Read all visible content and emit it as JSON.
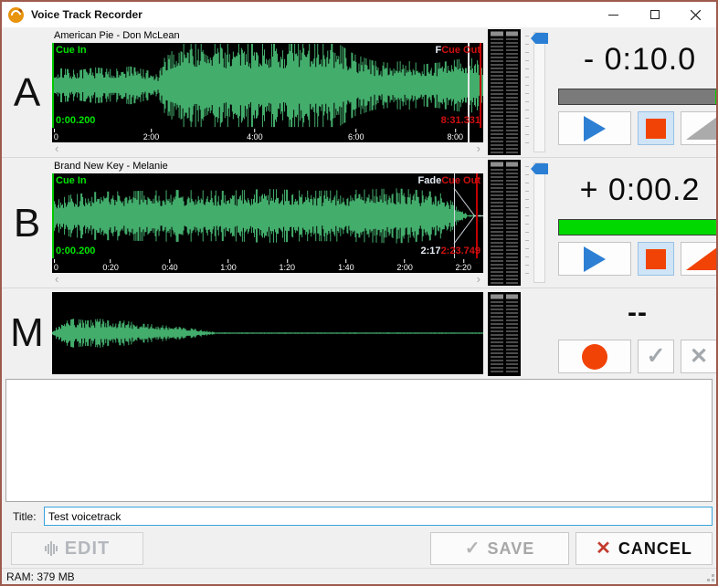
{
  "window": {
    "title": "Voice Track Recorder",
    "minimize": "minimize",
    "maximize": "maximize",
    "close": "close"
  },
  "colors": {
    "wave_green": "#43ad6c",
    "cue_green": "#00e400",
    "cue_red": "#d01010",
    "play_blue": "#2d7fd3",
    "stop_orange": "#f14306",
    "progress_green": "#00d800",
    "progress_gray": "#7a7a7a",
    "window_border": "#9d5b4d",
    "focus_blue": "#38a3dc"
  },
  "tracks": [
    {
      "label": "A",
      "song": "American Pie - Don McLean",
      "cue_in_label": "Cue In",
      "cue_in_time": "0:00.200",
      "fade_label": "F",
      "cue_out_label": "Cue Out",
      "fade_time": "",
      "cue_out_time": "8:31.331",
      "time_display": "- 0:10.0",
      "ruler": [
        {
          "t": "0",
          "p": 0.4
        },
        {
          "t": "2:00",
          "p": 23
        },
        {
          "t": "4:00",
          "p": 47
        },
        {
          "t": "6:00",
          "p": 70.5
        },
        {
          "t": "8:00",
          "p": 93.5
        }
      ],
      "playhead_pct": 96.4,
      "cueout_line_pct": 99.2,
      "progress": {
        "elapsed_pct": 96.5
      },
      "waveform": {
        "seed": 7,
        "envelope": [
          [
            0,
            0.22
          ],
          [
            0.02,
            0.34
          ],
          [
            0.06,
            0.3
          ],
          [
            0.1,
            0.36
          ],
          [
            0.14,
            0.32
          ],
          [
            0.18,
            0.38
          ],
          [
            0.22,
            0.3
          ],
          [
            0.245,
            0.2
          ],
          [
            0.27,
            0.8
          ],
          [
            0.32,
            0.9
          ],
          [
            0.45,
            0.88
          ],
          [
            0.5,
            0.92
          ],
          [
            0.55,
            0.85
          ],
          [
            0.6,
            0.9
          ],
          [
            0.66,
            0.85
          ],
          [
            0.7,
            0.62
          ],
          [
            0.74,
            0.5
          ],
          [
            0.78,
            0.45
          ],
          [
            0.82,
            0.5
          ],
          [
            0.86,
            0.42
          ],
          [
            0.9,
            0.46
          ],
          [
            0.94,
            0.52
          ],
          [
            0.97,
            0.55
          ],
          [
            1,
            0.45
          ]
        ]
      }
    },
    {
      "label": "B",
      "song": "Brand New Key - Melanie",
      "cue_in_label": "Cue In",
      "cue_in_time": "0:00.200",
      "fade_label": "Fade",
      "cue_out_label": "Cue Out",
      "fade_time": "2:17",
      "cue_out_time": "2:23.749",
      "time_display": "+ 0:00.2",
      "ruler": [
        {
          "t": "0",
          "p": 0.4
        },
        {
          "t": "0:20",
          "p": 13.6
        },
        {
          "t": "0:40",
          "p": 27.3
        },
        {
          "t": "1:00",
          "p": 40.9
        },
        {
          "t": "1:20",
          "p": 54.5
        },
        {
          "t": "1:40",
          "p": 68.2
        },
        {
          "t": "2:00",
          "p": 81.8
        },
        {
          "t": "2:20",
          "p": 95.4
        }
      ],
      "fade_start_pct": 93.2,
      "fade_apex_pct": 98.0,
      "cueout_line_pct": 98.3,
      "progress": {
        "elapsed_pct": 0
      },
      "waveform": {
        "seed": 21,
        "envelope": [
          [
            0,
            0.28
          ],
          [
            0.04,
            0.42
          ],
          [
            0.1,
            0.48
          ],
          [
            0.2,
            0.5
          ],
          [
            0.3,
            0.52
          ],
          [
            0.4,
            0.5
          ],
          [
            0.5,
            0.54
          ],
          [
            0.6,
            0.5
          ],
          [
            0.7,
            0.52
          ],
          [
            0.8,
            0.55
          ],
          [
            0.87,
            0.5
          ],
          [
            0.9,
            0.45
          ],
          [
            0.925,
            0.3
          ],
          [
            0.95,
            0.12
          ],
          [
            0.962,
            0.02
          ],
          [
            1,
            0.02
          ]
        ]
      }
    },
    {
      "label": "M",
      "time_display": "--",
      "waveform": {
        "seed": 33,
        "envelope": [
          [
            0,
            0.04
          ],
          [
            0.02,
            0.22
          ],
          [
            0.05,
            0.3
          ],
          [
            0.08,
            0.26
          ],
          [
            0.11,
            0.3
          ],
          [
            0.14,
            0.24
          ],
          [
            0.17,
            0.26
          ],
          [
            0.2,
            0.2
          ],
          [
            0.24,
            0.18
          ],
          [
            0.28,
            0.14
          ],
          [
            0.32,
            0.1
          ],
          [
            0.36,
            0.05
          ],
          [
            0.38,
            0.015
          ],
          [
            1,
            0.015
          ]
        ]
      }
    }
  ],
  "scroll": {
    "left": "‹",
    "right": "›"
  },
  "notes": {
    "value": ""
  },
  "title_field": {
    "label": "Title:",
    "value": "Test voicetrack"
  },
  "bottom": {
    "edit": "EDIT",
    "save": "SAVE",
    "cancel": "CANCEL",
    "check_glyph": "✓",
    "x_glyph": "✕"
  },
  "status": {
    "ram": "RAM: 379 MB"
  }
}
